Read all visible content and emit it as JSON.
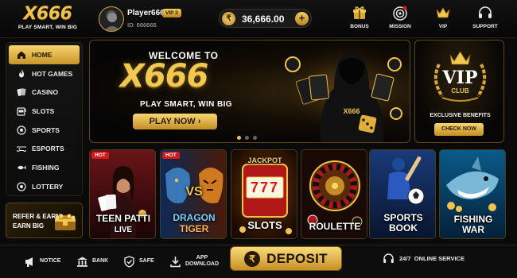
{
  "header": {
    "logo": "X666",
    "tagline": "PLAY SMART, WIN BIG",
    "player_name": "Player666",
    "vip_level": "VIP 3",
    "player_id": "ID: 666666",
    "balance": "36,666.00",
    "balance_icon": "rupee-coin-icon",
    "nav": [
      {
        "label": "BONUS",
        "icon": "gift-icon"
      },
      {
        "label": "MISSION",
        "icon": "target-icon"
      },
      {
        "label": "VIP",
        "icon": "crown-icon"
      },
      {
        "label": "SUPPORT",
        "icon": "headset-icon"
      }
    ]
  },
  "sidebar": {
    "items": [
      {
        "label": "HOME",
        "icon": "home-icon",
        "active": true
      },
      {
        "label": "HOT GAMES",
        "icon": "flame-icon"
      },
      {
        "label": "CASINO",
        "icon": "cards-icon"
      },
      {
        "label": "SLOTS",
        "icon": "slot-machine-icon"
      },
      {
        "label": "SPORTS",
        "icon": "soccer-ball-icon"
      },
      {
        "label": "ESPORTS",
        "icon": "gamepad-icon"
      },
      {
        "label": "FISHING",
        "icon": "fish-icon"
      },
      {
        "label": "LOTTERY",
        "icon": "lottery-ball-icon"
      }
    ],
    "refer": {
      "line1": "REFER & EARN",
      "line2": "EARN BIG"
    }
  },
  "banner": {
    "welcome": "WELCOME TO",
    "logo": "X666",
    "tagline": "PLAY SMART, WIN BIG",
    "cta": "PLAY NOW ›",
    "hoodie_text": "X666",
    "slide_count": 3,
    "active_slide": 0
  },
  "vip_panel": {
    "title": "VIP",
    "subtitle": "CLUB",
    "benefits": "EXCLUSIVE BENEFITS",
    "cta": "CHECK NOW"
  },
  "games": [
    {
      "title": "TEEN PATTI",
      "subtitle": "LIVE",
      "hot": "HOT"
    },
    {
      "title": "DRAGON",
      "subtitle": "TIGER",
      "hot": "HOT",
      "vs": "VS"
    },
    {
      "title": "SLOTS",
      "subtitle": "",
      "top": "JACKPOT",
      "reels": "777"
    },
    {
      "title": "ROULETTE",
      "subtitle": ""
    },
    {
      "title": "SPORTS",
      "subtitle": "BOOK"
    },
    {
      "title": "FISHING",
      "subtitle": "WAR"
    }
  ],
  "footer": {
    "notice": "NOTICE",
    "bank": "BANK",
    "safe": "SAFE",
    "app_line1": "APP",
    "app_line2": "DOWNLOAD",
    "deposit": "DEPOSIT",
    "deposit_icon": "rupee-coin-icon",
    "service": "24/7  ONLINE SERVICE"
  },
  "colors": {
    "gold": "#f1c24a",
    "gold_dark": "#c48d24",
    "hot_red": "#d21a1a",
    "background": "#0a0a0a"
  }
}
